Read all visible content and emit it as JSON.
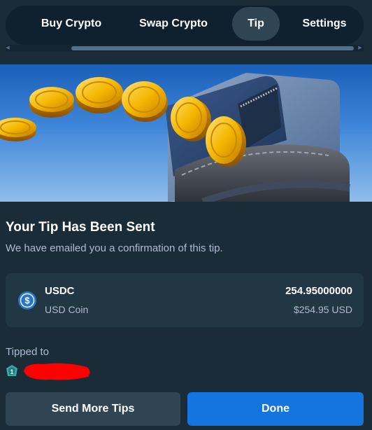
{
  "tabs": [
    {
      "label": "Buy Crypto"
    },
    {
      "label": "Swap Crypto"
    },
    {
      "label": "Tip",
      "active": true
    },
    {
      "label": "Settings"
    }
  ],
  "main": {
    "title": "Your Tip Has Been Sent",
    "subtitle": "We have emailed you a confirmation of this tip."
  },
  "coin": {
    "symbol": "USDC",
    "name": "USD Coin",
    "amount": "254.95000000",
    "fiat": "$254.95 USD",
    "icon": "usdc-icon",
    "icon_color": "#2775ca"
  },
  "recipient": {
    "label": "Tipped to",
    "badge_icon": "vip-badge-icon"
  },
  "buttons": {
    "secondary_label": "Send More Tips",
    "primary_label": "Done"
  },
  "colors": {
    "background": "#1a2c38",
    "card": "#213743",
    "accent": "#1475e1",
    "muted_text": "#b1bad3"
  }
}
